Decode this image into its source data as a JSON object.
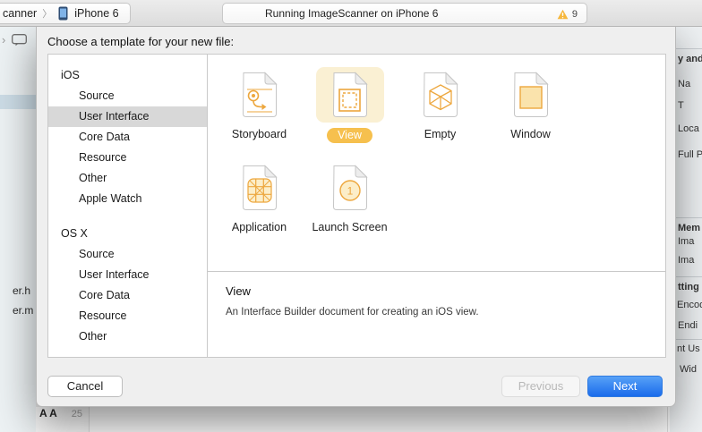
{
  "toolbar": {
    "scheme_fragment": "canner",
    "chevron": "〉",
    "destination": "iPhone 6",
    "activity_text": "Running ImageScanner on iPhone 6",
    "warning_count": "9"
  },
  "navigator": {
    "chevron": "›",
    "files": [
      "er.h",
      "er.m"
    ]
  },
  "editor": {
    "gutter_chars": "A A",
    "line_number": "25"
  },
  "inspector": {
    "fragments": [
      {
        "text": "y and"
      },
      {
        "text": "Na"
      },
      {
        "text": "T"
      },
      {
        "text": "Loca"
      },
      {
        "text": "Full P"
      },
      {
        "text": "Mem"
      },
      {
        "text": "Ima"
      },
      {
        "text": "Ima"
      },
      {
        "text": "tting"
      },
      {
        "text": "Encod"
      },
      {
        "text": "Endi"
      },
      {
        "text": "nt Us"
      },
      {
        "text": "Wid"
      }
    ]
  },
  "dialog": {
    "title": "Choose a template for your new file:",
    "sidebar": {
      "sections": [
        {
          "label": "iOS",
          "items": [
            "Source",
            "User Interface",
            "Core Data",
            "Resource",
            "Other",
            "Apple Watch"
          ]
        },
        {
          "label": "OS X",
          "items": [
            "Source",
            "User Interface",
            "Core Data",
            "Resource",
            "Other"
          ]
        }
      ],
      "selected_item": "User Interface"
    },
    "templates": [
      {
        "label": "Storyboard",
        "selected": false
      },
      {
        "label": "View",
        "selected": true
      },
      {
        "label": "Empty",
        "selected": false
      },
      {
        "label": "Window",
        "selected": false
      },
      {
        "label": "Application",
        "selected": false
      },
      {
        "label": "Launch Screen",
        "selected": false
      }
    ],
    "launch_screen_number": "1",
    "description": {
      "title": "View",
      "text": "An Interface Builder document for creating an iOS view."
    },
    "buttons": {
      "cancel": "Cancel",
      "previous": "Previous",
      "next": "Next"
    }
  },
  "colors": {
    "accent_orange": "#EDA73E",
    "selected_cell_bg": "#FAF0D3",
    "selected_pill": "#F6C04E",
    "sidebar_selected": "#D8D8D8",
    "next_button_blue": "#2F7DEF",
    "warning_yellow": "#F6B73C"
  }
}
